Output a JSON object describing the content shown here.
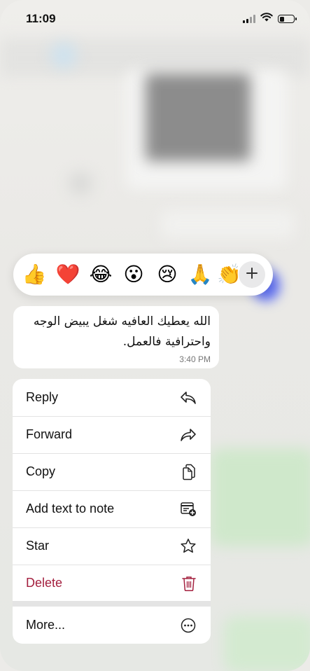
{
  "status_bar": {
    "time": "11:09",
    "icons": [
      "signal-icon",
      "wifi-icon",
      "battery-icon"
    ]
  },
  "reactions": {
    "emojis": [
      {
        "name": "thumbs-up",
        "glyph": "👍"
      },
      {
        "name": "red-heart",
        "glyph": "❤️"
      },
      {
        "name": "tears-of-joy",
        "glyph": "😂"
      },
      {
        "name": "surprised",
        "glyph": "😮"
      },
      {
        "name": "crying",
        "glyph": "😢"
      },
      {
        "name": "folded-hands",
        "glyph": "🙏"
      },
      {
        "name": "clapping-hands",
        "glyph": "👏"
      }
    ],
    "more_icon": "plus-icon"
  },
  "message": {
    "text": "الله يعطيك العافيه شغل يبيض الوجه واحترافية فالعمل.",
    "time": "3:40 PM"
  },
  "menu": {
    "items": [
      {
        "label": "Reply",
        "icon": "reply-icon"
      },
      {
        "label": "Forward",
        "icon": "forward-icon"
      },
      {
        "label": "Copy",
        "icon": "copy-icon"
      },
      {
        "label": "Add text to note",
        "icon": "add-note-icon"
      },
      {
        "label": "Star",
        "icon": "star-icon"
      },
      {
        "label": "Delete",
        "icon": "trash-icon"
      },
      {
        "label": "More...",
        "icon": "more-icon"
      }
    ]
  },
  "colors": {
    "danger": "#a4203f",
    "menu_bg": "#ffffff",
    "reaction_bg": "#ffffff"
  }
}
